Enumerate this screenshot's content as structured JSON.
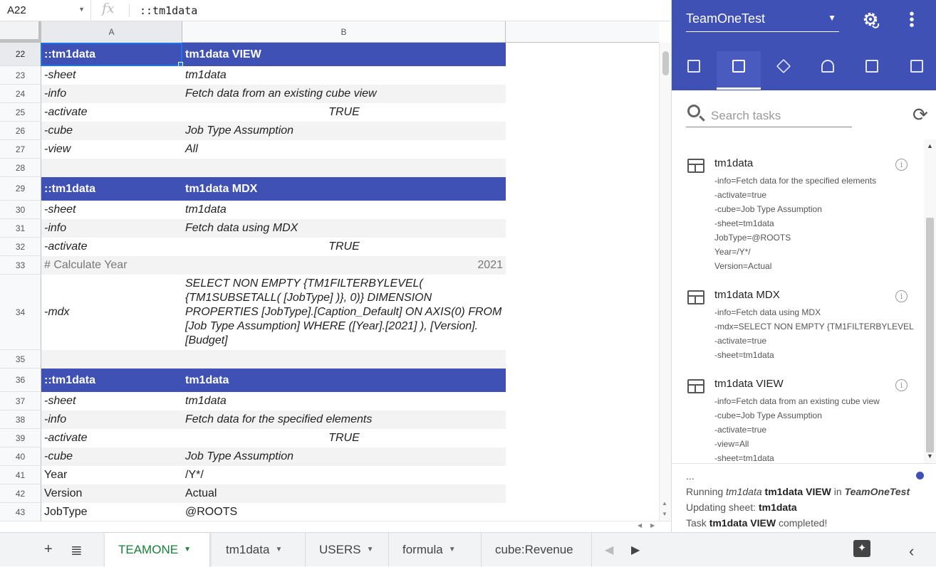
{
  "formula_bar": {
    "cell_ref": "A22",
    "fx": "fx",
    "formula": "::tm1data"
  },
  "columns": [
    "A",
    "B"
  ],
  "rows": [
    {
      "num": "22",
      "a": "::tm1data",
      "b": "tm1data VIEW",
      "style": "hdr"
    },
    {
      "num": "23",
      "a": "-sheet",
      "b": "tm1data",
      "style": "odd"
    },
    {
      "num": "24",
      "a": "-info",
      "b": "Fetch data from an existing cube view",
      "style": "even"
    },
    {
      "num": "25",
      "a": "-activate",
      "b": "TRUE",
      "style": "odd"
    },
    {
      "num": "26",
      "a": "-cube",
      "b": "Job Type Assumption",
      "style": "even"
    },
    {
      "num": "27",
      "a": "-view",
      "b": "All",
      "style": "odd"
    },
    {
      "num": "28",
      "a": "",
      "b": "",
      "style": "even"
    },
    {
      "num": "29",
      "a": "::tm1data",
      "b": "tm1data MDX",
      "style": "hdr"
    },
    {
      "num": "30",
      "a": "-sheet",
      "b": "tm1data",
      "style": "odd"
    },
    {
      "num": "31",
      "a": "-info",
      "b": "Fetch data using MDX",
      "style": "even"
    },
    {
      "num": "32",
      "a": "-activate",
      "b": "TRUE",
      "style": "odd"
    },
    {
      "num": "33",
      "a": "# Calculate Year",
      "b": "2021",
      "style": "even"
    },
    {
      "num": "34",
      "a": "-mdx",
      "b": "SELECT NON EMPTY {TM1FILTERBYLEVEL( {TM1SUBSETALL( [JobType] )}, 0)} DIMENSION PROPERTIES [JobType].[Caption_Default] ON AXIS(0) FROM [Job Type Assumption] WHERE ([Year].[2021] ), [Version].[Budget]",
      "style": "odd"
    },
    {
      "num": "35",
      "a": "",
      "b": "",
      "style": "even"
    },
    {
      "num": "36",
      "a": "::tm1data",
      "b": "tm1data",
      "style": "hdr"
    },
    {
      "num": "37",
      "a": "-sheet",
      "b": "tm1data",
      "style": "odd"
    },
    {
      "num": "38",
      "a": "-info",
      "b": "Fetch data for the specified elements",
      "style": "even"
    },
    {
      "num": "39",
      "a": "-activate",
      "b": "TRUE",
      "style": "odd"
    },
    {
      "num": "40",
      "a": "-cube",
      "b": "Job Type Assumption",
      "style": "even"
    },
    {
      "num": "41",
      "a": "Year",
      "b": "/Y*/",
      "style": "odd"
    },
    {
      "num": "42",
      "a": "Version",
      "b": "Actual",
      "style": "even"
    },
    {
      "num": "43",
      "a": "JobType",
      "b": "@ROOTS",
      "style": "odd"
    }
  ],
  "sheet_tabs": [
    {
      "label": "TEAMONE",
      "active": true
    },
    {
      "label": "tm1data",
      "active": false
    },
    {
      "label": "USERS",
      "active": false
    },
    {
      "label": "formula",
      "active": false
    },
    {
      "label": "cube:Revenue",
      "active": false
    }
  ],
  "panel": {
    "workspace": "TeamOneTest",
    "search_placeholder": "Search tasks",
    "tabs": [
      "table-icon",
      "tasks-icon",
      "cube-icon",
      "users-icon",
      "calendar-icon",
      "calculator-icon"
    ],
    "tasks": [
      {
        "name": "tm1data",
        "lines": [
          "-info=Fetch data for the specified elements",
          "-activate=true",
          "-cube=Job Type Assumption",
          "-sheet=tm1data",
          "JobType=@ROOTS",
          "Year=/Y*/",
          "Version=Actual"
        ]
      },
      {
        "name": "tm1data MDX",
        "lines": [
          "-info=Fetch data using MDX",
          "-mdx=SELECT NON EMPTY {TM1FILTERBYLEVEL",
          "-activate=true",
          "-sheet=tm1data"
        ]
      },
      {
        "name": "tm1data VIEW",
        "lines": [
          "-info=Fetch data from an existing cube view",
          "-cube=Job Type Assumption",
          "-activate=true",
          "-view=All",
          "-sheet=tm1data"
        ]
      }
    ],
    "status": {
      "ellipsis": "...",
      "l1_prefix": "Running",
      "l1_task_sheet": "tm1data",
      "l1_task_name": "tm1data VIEW",
      "l1_in": "in",
      "l1_workspace": "TeamOneTest",
      "l2_prefix": "Updating sheet:",
      "l2_sheet": "tm1data",
      "l3_prefix": "Task",
      "l3_task": "tm1data VIEW",
      "l3_suffix": "completed!"
    }
  },
  "colors": {
    "header_blue": "#3f51b5",
    "active_tab_green": "#188038",
    "selection_blue": "#1a73e8"
  }
}
